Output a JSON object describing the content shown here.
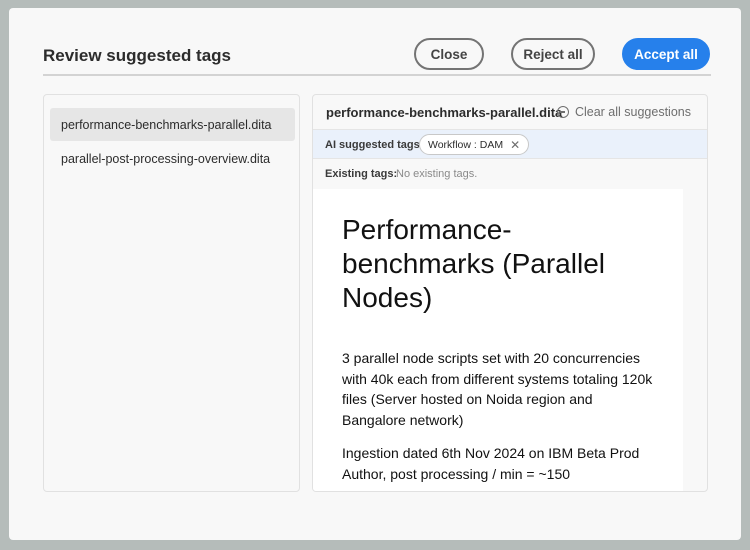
{
  "header": {
    "title": "Review suggested tags",
    "close_label": "Close",
    "reject_all_label": "Reject all",
    "accept_all_label": "Accept all"
  },
  "files": [
    {
      "name": "performance-benchmarks-parallel.dita",
      "selected": true
    },
    {
      "name": "parallel-post-processing-overview.dita",
      "selected": false
    }
  ],
  "preview": {
    "file_title": "performance-benchmarks-parallel.dita",
    "clear_all_label": "Clear all suggestions",
    "ai_tags_label": "AI suggested tags:",
    "ai_tags": [
      "Workflow : DAM"
    ],
    "existing_tags_label": "Existing tags:",
    "existing_tags_value": "No existing tags."
  },
  "document": {
    "heading": "Performance-benchmarks (Parallel Nodes)",
    "paragraphs": [
      "3 parallel node scripts set with 20 concurrencies with 40k each from different systems totaling 120k files (Server hosted on Noida region and Bangalore network)",
      "Ingestion dated 6th Nov 2024 on IBM Beta Prod Author, post processing / min = ~150"
    ]
  },
  "colors": {
    "accent": "#2680eb",
    "ai_row_bg": "#eaf1fb",
    "backdrop": "#b5bcba"
  }
}
